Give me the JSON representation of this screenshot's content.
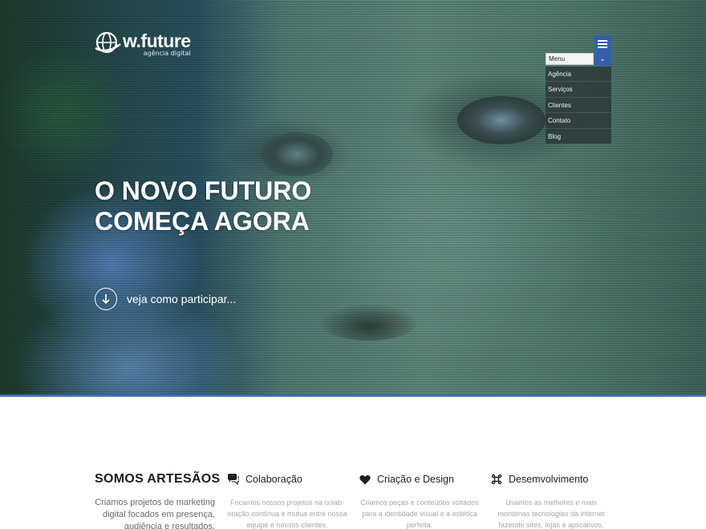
{
  "hero": {
    "logo": {
      "word": "w.future",
      "sub": "agência digital"
    },
    "menu": {
      "select_label": "Menu",
      "items": [
        "Agência",
        "Serviços",
        "Clientes",
        "Contato",
        "Blog"
      ]
    },
    "title_line1": "O NOVO FUTURO",
    "title_line2": "COMEÇA AGORA",
    "cta_label": "veja como participar..."
  },
  "about": {
    "heading": "SOMOS ARTESÃOS",
    "text": "Criamos projetos de marketing digital focados em presença, audiência e resultados."
  },
  "features": [
    {
      "icon": "speech-bubbles-icon",
      "title": "Colaboração",
      "text": "Focamos nossos projetos na colab-oração contínua e mutua entre nossa equipe e nossos clientes."
    },
    {
      "icon": "heart-icon",
      "title": "Criação e Design",
      "text": "Criamos peças e conteúdos voltados para a identidade visual e a estética perfeita."
    },
    {
      "icon": "command-icon",
      "title": "Desemvolvimento",
      "text": "Usamos as melhores e mais mordenas tecnologias da internet fazendo sites, lojas e aplicativos."
    }
  ],
  "colors": {
    "accent": "#3560a6",
    "hero_border": "#3f6fb0"
  }
}
